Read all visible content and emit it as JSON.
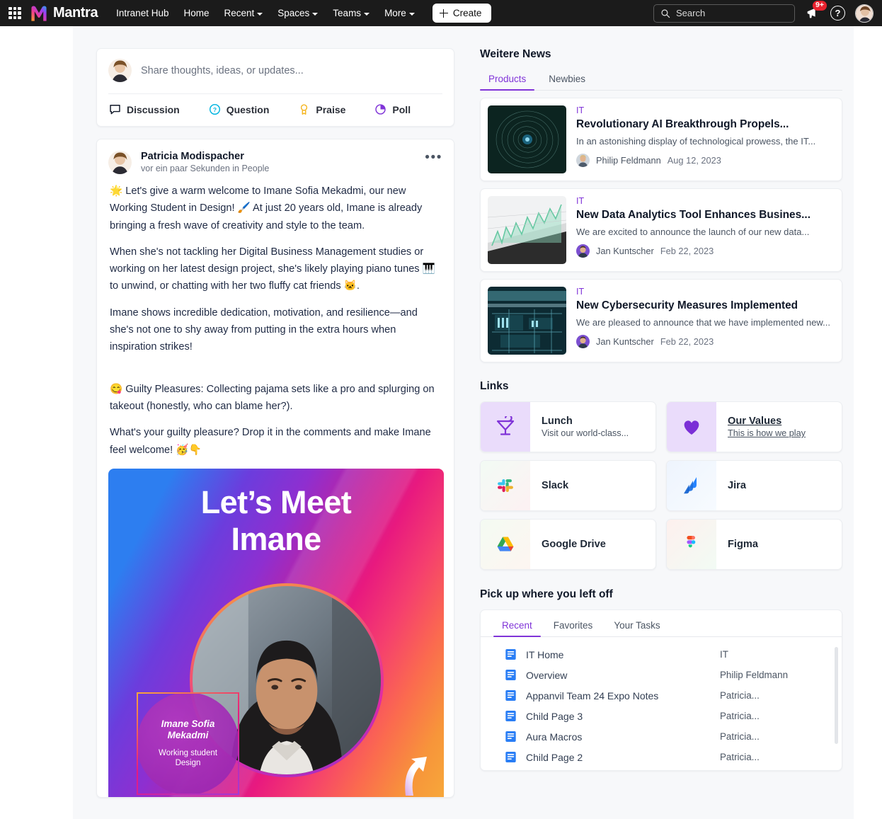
{
  "app": {
    "brand_name": "Mantra",
    "nav_links": [
      {
        "label": "Intranet Hub",
        "caret": false
      },
      {
        "label": "Home",
        "caret": false
      },
      {
        "label": "Recent",
        "caret": true
      },
      {
        "label": "Spaces",
        "caret": true
      },
      {
        "label": "Teams",
        "caret": true
      },
      {
        "label": "More",
        "caret": true
      }
    ],
    "create_label": "Create",
    "search_placeholder": "Search",
    "notification_badge": "9+",
    "help_label": "?",
    "accent": "#8034d8",
    "header_bg": "#1b1b1b"
  },
  "composer": {
    "placeholder": "Share thoughts, ideas, or updates...",
    "actions": [
      {
        "label": "Discussion",
        "icon": "speech-bubble-icon",
        "color": "#101828"
      },
      {
        "label": "Question",
        "icon": "question-circle-icon",
        "color": "#00b4e0"
      },
      {
        "label": "Praise",
        "icon": "award-ribbon-icon",
        "color": "#f5b623"
      },
      {
        "label": "Poll",
        "icon": "pie-chart-icon",
        "color": "#8034d8"
      }
    ]
  },
  "post": {
    "author": "Patricia Modispacher",
    "meta": "vor ein paar Sekunden in People",
    "more_label": "•••",
    "paragraphs": [
      "🌟 Let's give a warm welcome to Imane Sofia Mekadmi, our new Working Student in Design! 🖌️ At just 20 years old, Imane is already bringing a fresh wave of creativity and style to the team.",
      "When she's not tackling her Digital Business Management studies or working on her latest design project, she's likely playing piano tunes 🎹 to unwind, or chatting with her two fluffy cat friends 🐱.",
      "Imane shows incredible dedication, motivation, and resilience—and she's not one to shy away from putting in the extra hours when inspiration strikes!",
      "😋 Guilty Pleasures: Collecting pajama sets like a pro and splurging on takeout (honestly, who can blame her?).",
      "What's your guilty pleasure? Drop it in the comments and make Imane feel welcome! 🥳👇"
    ],
    "poster": {
      "title_line1": "Let’s Meet",
      "title_line2": "Imane",
      "bubble_name_line1": "Imane Sofia",
      "bubble_name_line2": "Mekadmi",
      "bubble_role_line1": "Working student",
      "bubble_role_line2": "Design"
    }
  },
  "news": {
    "heading": "Weitere News",
    "tabs": [
      {
        "label": "Products",
        "active": true
      },
      {
        "label": "Newbies",
        "active": false
      }
    ],
    "items": [
      {
        "category": "IT",
        "title": "Revolutionary AI Breakthrough Propels...",
        "desc": "In an astonishing display of technological prowess, the IT...",
        "author": "Philip Feldmann",
        "date": "Aug 12, 2023",
        "thumb": "ai-swirl-image"
      },
      {
        "category": "IT",
        "title": "New Data Analytics Tool Enhances Busines...",
        "desc": "We are excited to announce the launch of our new data...",
        "author": "Jan Kuntscher",
        "date": "Feb 22, 2023",
        "thumb": "analytics-chart-image"
      },
      {
        "category": "IT",
        "title": "New Cybersecurity Measures Implemented",
        "desc": "We are pleased to announce that we have implemented new...",
        "author": "Jan Kuntscher",
        "date": "Feb 22, 2023",
        "thumb": "circuit-board-image"
      }
    ]
  },
  "links": {
    "heading": "Links",
    "items": [
      {
        "title": "Lunch",
        "subtitle": "Visit our world-class...",
        "icon": "cocktail-glass-icon",
        "underline": false
      },
      {
        "title": "Our Values",
        "subtitle": "This is how we play",
        "icon": "heart-icon",
        "underline": true
      },
      {
        "title": "Slack",
        "subtitle": "",
        "icon": "slack-icon",
        "underline": false
      },
      {
        "title": "Jira",
        "subtitle": "",
        "icon": "jira-icon",
        "underline": false
      },
      {
        "title": "Google Drive",
        "subtitle": "",
        "icon": "google-drive-icon",
        "underline": false
      },
      {
        "title": "Figma",
        "subtitle": "",
        "icon": "figma-icon",
        "underline": false
      }
    ]
  },
  "pickup": {
    "heading": "Pick up where you left off",
    "tabs": [
      {
        "label": "Recent",
        "active": true
      },
      {
        "label": "Favorites",
        "active": false
      },
      {
        "label": "Your Tasks",
        "active": false
      }
    ],
    "rows": [
      {
        "name": "IT Home",
        "owner": "IT"
      },
      {
        "name": "Overview",
        "owner": "Philip Feldmann"
      },
      {
        "name": "Appanvil Team 24 Expo Notes",
        "owner": "Patricia..."
      },
      {
        "name": "Child Page 3",
        "owner": "Patricia..."
      },
      {
        "name": "Aura Macros",
        "owner": "Patricia..."
      },
      {
        "name": "Child Page 2",
        "owner": "Patricia..."
      }
    ]
  }
}
